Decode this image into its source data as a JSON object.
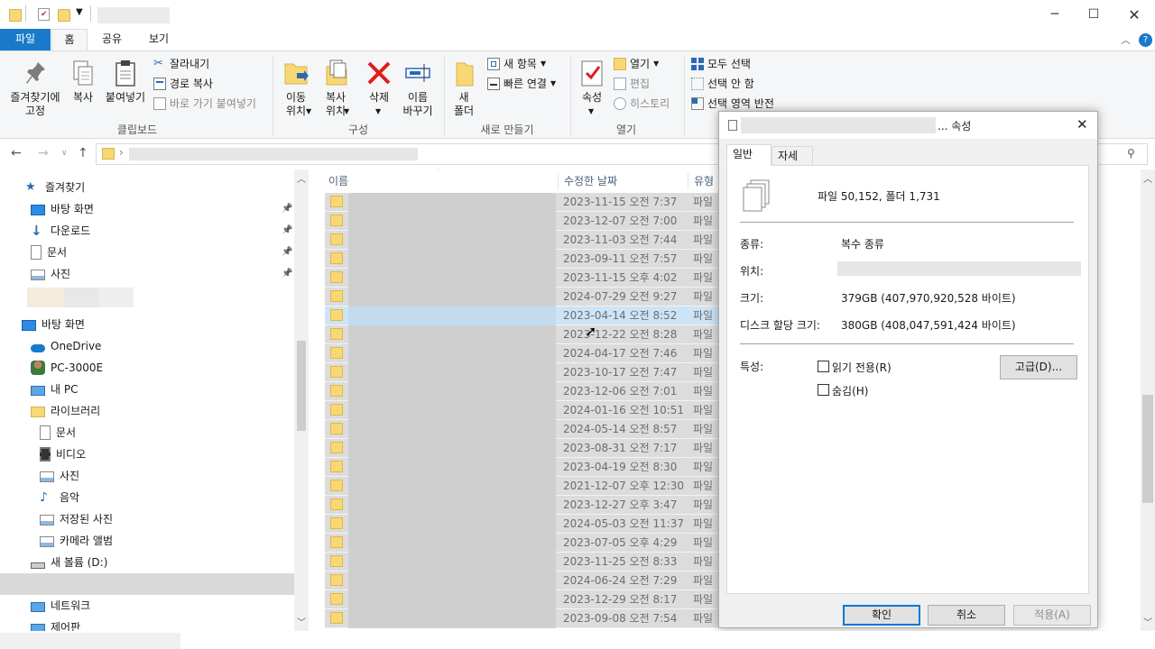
{
  "ribbon_tabs": [
    "파일",
    "홈",
    "공유",
    "보기"
  ],
  "ribbon": {
    "clipboard": {
      "pin_quick": "즐겨찾기에\n고정",
      "copy": "복사",
      "paste": "붙여넣기",
      "cut": "잘라내기",
      "copy_path": "경로 복사",
      "paste_shortcut": "바로 가기 붙여넣기",
      "group": "클립보드"
    },
    "organize": {
      "move_to": "이동\n위치",
      "copy_to": "복사\n위치",
      "delete": "삭제",
      "rename": "이름\n바꾸기",
      "group": "구성"
    },
    "new": {
      "new_folder": "새\n폴더",
      "new_item": "새 항목",
      "easy_access": "빠른 연결",
      "group": "새로 만들기"
    },
    "open": {
      "properties": "속성",
      "open": "열기",
      "edit": "편집",
      "history": "히스토리",
      "group": "열기"
    },
    "select": {
      "select_all": "모두 선택",
      "select_none": "선택 안 함",
      "invert": "선택 영역 반전"
    }
  },
  "nav": {
    "items": [
      {
        "label": "즐겨찾기",
        "icon": "star-icon",
        "pinned": false
      },
      {
        "label": "바탕 화면",
        "icon": "desktop-icon",
        "pinned": true
      },
      {
        "label": "다운로드",
        "icon": "download-icon",
        "pinned": true
      },
      {
        "label": "문서",
        "icon": "document-icon",
        "pinned": true
      },
      {
        "label": "사진",
        "icon": "pictures-icon",
        "pinned": true
      },
      {
        "label": "바탕 화면",
        "icon": "desktop-icon",
        "pinned": false
      },
      {
        "label": "OneDrive",
        "icon": "cloud-icon",
        "pinned": false
      },
      {
        "label": "PC-3000E",
        "icon": "user-icon",
        "pinned": false
      },
      {
        "label": "내 PC",
        "icon": "pc-icon",
        "pinned": false
      },
      {
        "label": "라이브러리",
        "icon": "library-icon",
        "pinned": false
      },
      {
        "label": "문서",
        "icon": "document-icon",
        "pinned": false
      },
      {
        "label": "비디오",
        "icon": "video-icon",
        "pinned": false
      },
      {
        "label": "사진",
        "icon": "pictures-icon",
        "pinned": false
      },
      {
        "label": "음악",
        "icon": "music-icon",
        "pinned": false
      },
      {
        "label": "저장된 사진",
        "icon": "pictures-icon",
        "pinned": false
      },
      {
        "label": "카메라 앨범",
        "icon": "pictures-icon",
        "pinned": false
      },
      {
        "label": "새 볼륨 (D:)",
        "icon": "drive-icon",
        "pinned": false
      },
      {
        "label": "네트워크",
        "icon": "network-icon",
        "pinned": false
      },
      {
        "label": "제어판",
        "icon": "control-panel-icon",
        "pinned": false
      }
    ]
  },
  "filelist": {
    "columns": {
      "name": "이름",
      "date": "수정한 날짜",
      "type": "유형"
    },
    "rows": [
      {
        "date": "2023-11-15 오전 7:37",
        "type": "파일"
      },
      {
        "date": "2023-12-07 오전 7:00",
        "type": "파일"
      },
      {
        "date": "2023-11-03 오전 7:44",
        "type": "파일"
      },
      {
        "date": "2023-09-11 오전 7:57",
        "type": "파일"
      },
      {
        "date": "2023-11-15 오후 4:02",
        "type": "파일"
      },
      {
        "date": "2024-07-29 오전 9:27",
        "type": "파일"
      },
      {
        "date": "2023-04-14 오전 8:52",
        "type": "파일"
      },
      {
        "date": "2023-12-22 오전 8:28",
        "type": "파일"
      },
      {
        "date": "2024-04-17 오전 7:46",
        "type": "파일"
      },
      {
        "date": "2023-10-17 오전 7:47",
        "type": "파일"
      },
      {
        "date": "2023-12-06 오전 7:01",
        "type": "파일"
      },
      {
        "date": "2024-01-16 오전 10:51",
        "type": "파일"
      },
      {
        "date": "2024-05-14 오전 8:57",
        "type": "파일"
      },
      {
        "date": "2023-08-31 오전 7:17",
        "type": "파일"
      },
      {
        "date": "2023-04-19 오전 8:30",
        "type": "파일"
      },
      {
        "date": "2021-12-07 오후 12:30",
        "type": "파일"
      },
      {
        "date": "2023-12-27 오후 3:47",
        "type": "파일"
      },
      {
        "date": "2024-05-03 오전 11:37",
        "type": "파일"
      },
      {
        "date": "2023-07-05 오후 4:29",
        "type": "파일"
      },
      {
        "date": "2023-11-25 오전 8:33",
        "type": "파일"
      },
      {
        "date": "2024-06-24 오전 7:29",
        "type": "파일"
      },
      {
        "date": "2023-12-29 오전 8:17",
        "type": "파일"
      },
      {
        "date": "2023-09-08 오전 7:54",
        "type": "파일"
      }
    ],
    "selected_index": 6
  },
  "dialog": {
    "title_suffix": "... 속성",
    "tabs": [
      "일반",
      "자세히"
    ],
    "summary": "파일 50,152, 폴더 1,731",
    "type_label": "종류:",
    "type_value": "복수 종류",
    "location_label": "위치:",
    "size_label": "크기:",
    "size_value": "379GB (407,970,920,528 바이트)",
    "disk_label": "디스크 할당 크기:",
    "disk_value": "380GB (408,047,591,424 바이트)",
    "attr_label": "특성:",
    "readonly": "읽기 전용(R)",
    "hidden": "숨김(H)",
    "advanced": "고급(D)...",
    "ok": "확인",
    "cancel": "취소",
    "apply": "적용(A)"
  }
}
